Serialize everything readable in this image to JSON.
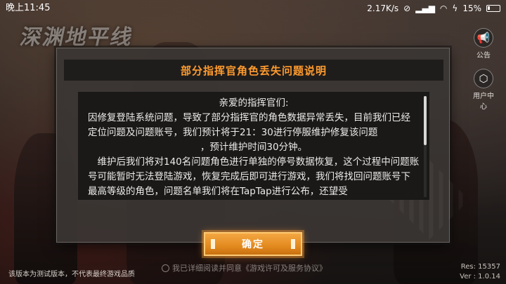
{
  "status_bar": {
    "time": "晚上11:45",
    "net_speed": "2.17K/s",
    "battery_percent": "15%"
  },
  "background": {
    "logo_text": "深渊地平线"
  },
  "side_buttons": [
    {
      "label": "公告",
      "icon": "megaphone-icon"
    },
    {
      "label": "用户中心",
      "icon": "settings-hex-icon"
    }
  ],
  "dialog": {
    "title": "部分指挥官角色丢失问题说明",
    "greeting": "亲爱的指挥官们:",
    "paragraph1": "因修复登陆系统问题，导致了部分指挥官的角色数据异常丢失，目前我们已经定位问题及问题账号，我们预计将于21：30进行停服维护修复该问题",
    "paragraph1_tail": "，预计维护时间30分钟。",
    "paragraph2": "维护后我们将对140名问题角色进行单独的停号数据恢复，这个过程中问题账号可能暂时无法登陆游戏，恢复完成后即可进行游戏，我们将找回问题账号下最高等级的角色，问题名单我们将在TapTap进行公布，还望受",
    "confirm_label": "确定"
  },
  "footer": {
    "disclaimer": "该版本为测试版本，不代表最终游戏品质",
    "agreement": "我已详细阅读并同意《游戏许可及服务协议》",
    "res": "Res: 15357",
    "ver": "Ver : 1.0.14"
  },
  "colors": {
    "title_orange": "#ff9b2e",
    "button_orange": "#e38a1f"
  }
}
